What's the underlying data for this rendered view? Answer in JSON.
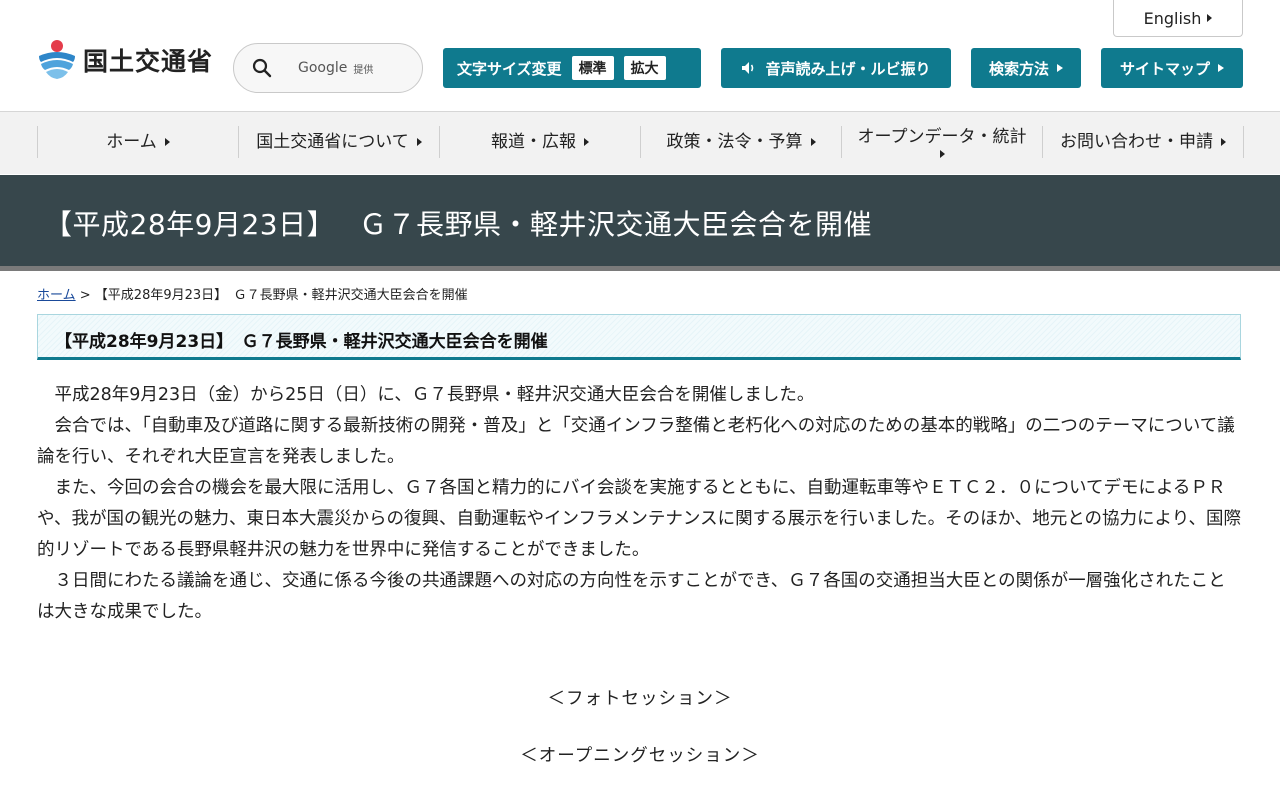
{
  "header": {
    "english_label": "English",
    "logo_text": "国土交通省",
    "search": {
      "provider": "Google",
      "provided": "提供"
    },
    "font_size": {
      "label": "文字サイズ変更",
      "normal": "標準",
      "large": "拡大"
    },
    "voice_label": "音声読み上げ・ルビ振り",
    "search_method_label": "検索方法",
    "sitemap_label": "サイトマップ",
    "accent_color": "#0f7a8e"
  },
  "nav": {
    "items": [
      "ホーム",
      "国土交通省について",
      "報道・広報",
      "政策・法令・予算",
      "オープンデータ・統計",
      "お問い合わせ・申請"
    ]
  },
  "page": {
    "title": "【平成28年9月23日】　 Ｇ７長野県・軽井沢交通大臣会合を開催",
    "breadcrumb_home": "ホーム",
    "breadcrumb_sep": " > ",
    "breadcrumb_current": "【平成28年9月23日】　Ｇ７長野県・軽井沢交通大臣会合を開催",
    "heading": "【平成28年9月23日】　Ｇ７長野県・軽井沢交通大臣会合を開催",
    "paragraphs": [
      "平成28年9月23日（金）から25日（日）に、Ｇ７長野県・軽井沢交通大臣会合を開催しました。",
      "会合では、「自動車及び道路に関する最新技術の開発・普及」と「交通インフラ整備と老朽化への対応のための基本的戦略」の二つのテーマについて議論を行い、それぞれ大臣宣言を発表しました。",
      "また、今回の会合の機会を最大限に活用し、Ｇ７各国と精力的にバイ会談を実施するとともに、自動運転車等やＥＴＣ２．０についてデモによるＰＲや、我が国の観光の魅力、東日本大震災からの復興、自動運転やインフラメンテナンスに関する展示を行いました。そのほか、地元との協力により、国際的リゾートである長野県軽井沢の魅力を世界中に発信することができました。",
      "３日間にわたる議論を通じ、交通に係る今後の共通課題への対応の方向性を示すことができ、Ｇ７各国の交通担当大臣との関係が一層強化されたことは大きな成果でした。"
    ],
    "photo_session": "＜フォトセッション＞",
    "opening_session": "＜オープニングセッション＞"
  }
}
